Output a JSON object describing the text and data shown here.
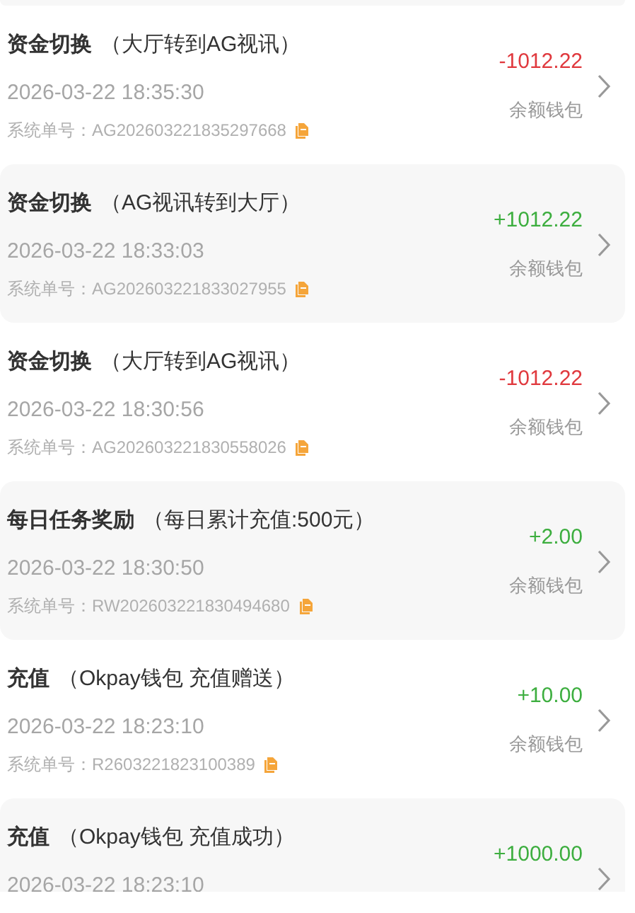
{
  "records": [
    {
      "title": "资金切换",
      "detail": "（大厅转到AG视讯）",
      "time": "2026-03-22 18:35:30",
      "order_label": "系统单号：",
      "order_no": "AG202603221835297668",
      "amount": "-1012.22",
      "kind": "debit",
      "wallet": "余额钱包"
    },
    {
      "title": "资金切换",
      "detail": "（AG视讯转到大厅）",
      "time": "2026-03-22 18:33:03",
      "order_label": "系统单号：",
      "order_no": "AG202603221833027955",
      "amount": "+1012.22",
      "kind": "credit",
      "wallet": "余额钱包"
    },
    {
      "title": "资金切换",
      "detail": "（大厅转到AG视讯）",
      "time": "2026-03-22 18:30:56",
      "order_label": "系统单号：",
      "order_no": "AG202603221830558026",
      "amount": "-1012.22",
      "kind": "debit",
      "wallet": "余额钱包"
    },
    {
      "title": "每日任务奖励",
      "detail": "（每日累计充值:500元）",
      "time": "2026-03-22 18:30:50",
      "order_label": "系统单号：",
      "order_no": "RW202603221830494680",
      "amount": "+2.00",
      "kind": "credit",
      "wallet": "余额钱包"
    },
    {
      "title": "充值",
      "detail": "（Okpay钱包 充值赠送）",
      "time": "2026-03-22 18:23:10",
      "order_label": "系统单号：",
      "order_no": "R2603221823100389",
      "amount": "+10.00",
      "kind": "credit",
      "wallet": "余额钱包"
    },
    {
      "title": "充值",
      "detail": "（Okpay钱包 充值成功）",
      "time": "2026-03-22 18:23:10",
      "amount": "+1000.00",
      "kind": "credit"
    }
  ]
}
